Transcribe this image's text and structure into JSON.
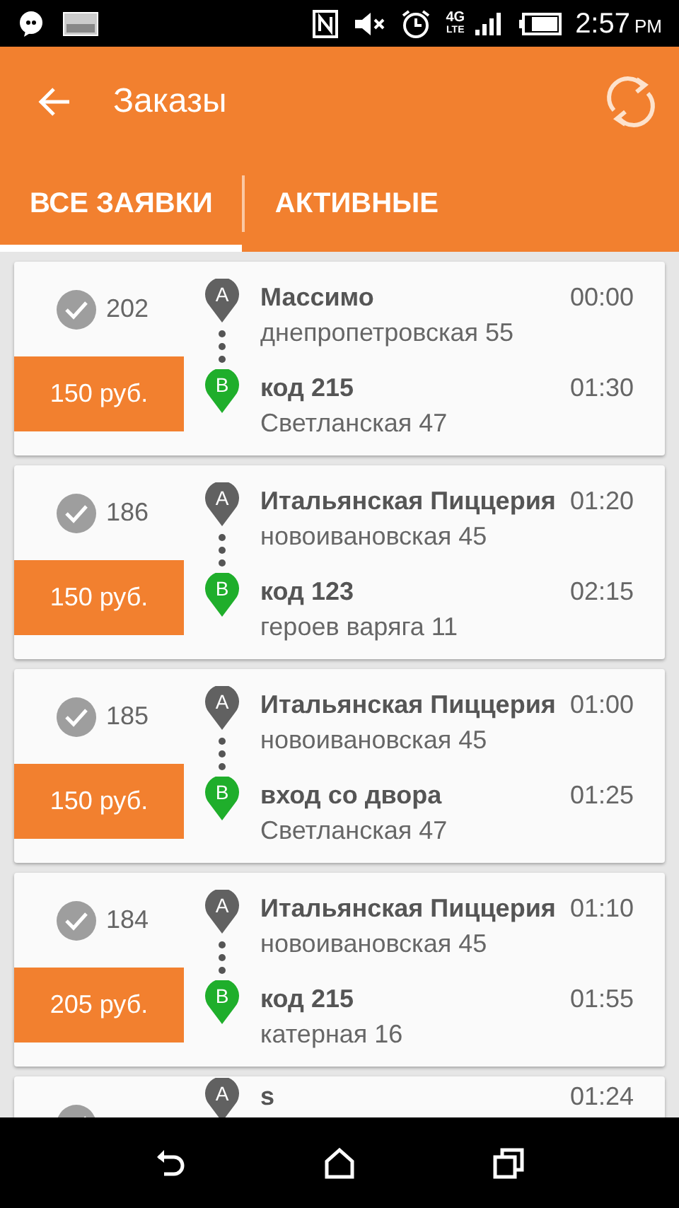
{
  "status_bar": {
    "network": "4G",
    "network_sub": "LTE",
    "time": "2:57",
    "ampm": "PM"
  },
  "header": {
    "title": "Заказы"
  },
  "tabs": [
    {
      "label": "ВСЕ ЗАЯВКИ",
      "selected": true
    },
    {
      "label": "АКТИВНЫЕ",
      "selected": false
    }
  ],
  "orders": [
    {
      "number": "202",
      "price": "150 руб.",
      "stops": [
        {
          "kind": "pickup",
          "letter": "A",
          "name": "Массимо",
          "address": "днепропетровская 55",
          "time": "00:00"
        },
        {
          "kind": "dropoff",
          "letter": "B",
          "name": "код 215",
          "address": "Светланская 47",
          "time": "01:30"
        }
      ]
    },
    {
      "number": "186",
      "price": "150 руб.",
      "stops": [
        {
          "kind": "pickup",
          "letter": "A",
          "name": "Итальянская Пиццерия",
          "address": "новоивановская 45",
          "time": "01:20"
        },
        {
          "kind": "dropoff",
          "letter": "B",
          "name": "код 123",
          "address": "героев варяга 11",
          "time": "02:15"
        }
      ]
    },
    {
      "number": "185",
      "price": "150 руб.",
      "stops": [
        {
          "kind": "pickup",
          "letter": "A",
          "name": "Итальянская Пиццерия",
          "address": "новоивановская 45",
          "time": "01:00"
        },
        {
          "kind": "dropoff",
          "letter": "B",
          "name": "вход со двора",
          "address": "Светланская 47",
          "time": "01:25"
        }
      ]
    },
    {
      "number": "184",
      "price": "205 руб.",
      "stops": [
        {
          "kind": "pickup",
          "letter": "A",
          "name": "Итальянская Пиццерия",
          "address": "новоивановская 45",
          "time": "01:10"
        },
        {
          "kind": "dropoff",
          "letter": "B",
          "name": "код 215",
          "address": "катерная 16",
          "time": "01:55"
        }
      ]
    },
    {
      "stops": [
        {
          "kind": "pickup",
          "letter": "A",
          "name": "s",
          "time": "01:24"
        }
      ]
    }
  ]
}
